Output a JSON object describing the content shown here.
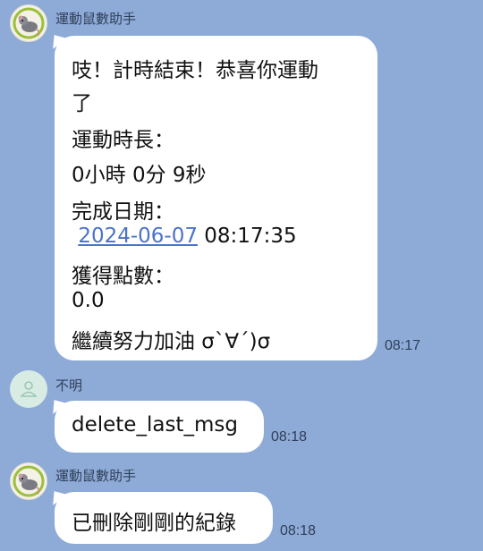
{
  "messages": [
    {
      "sender": "運動鼠數助手",
      "avatar": "rat-bot-icon",
      "time": "08:17",
      "lines": [
        "吱！計時結束！恭喜你運動",
        "了",
        "運動時長：",
        " 0小時 0分 9秒",
        "完成日期：",
        "",
        "獲得點數：",
        " 0.0",
        "繼續努力加油 σ`∀´)σ"
      ],
      "date_link": "2024-06-07",
      "date_time_rest": " 08:17:35"
    },
    {
      "sender": "不明",
      "avatar": "default-user-icon",
      "time": "08:18",
      "text": "delete_last_msg"
    },
    {
      "sender": "運動鼠數助手",
      "avatar": "rat-bot-icon",
      "time": "08:18",
      "text": "已刪除剛剛的紀錄"
    }
  ],
  "colors": {
    "background": "#8eabd8",
    "bubble": "#ffffff",
    "link": "#4a73c7"
  }
}
